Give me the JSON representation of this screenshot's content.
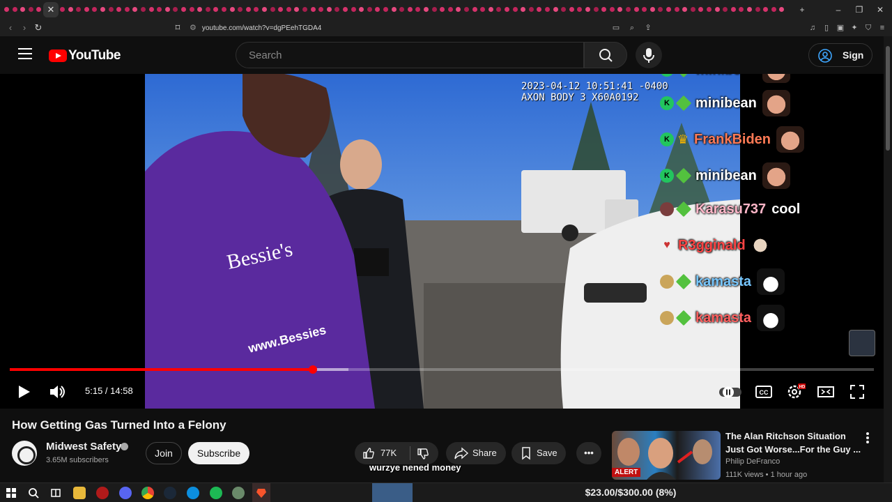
{
  "browser": {
    "url": "youtube.com/watch?v=dgPEehTGDA4",
    "tab_count_visible": 95
  },
  "header": {
    "logo_text": "YouTube",
    "search_placeholder": "Search",
    "signin_label": "Sign in"
  },
  "player": {
    "timestamp_overlay": "2023-04-12 10:51:41 -0400\nAXON BODY 3 X60A0192",
    "time_display": "5:15 / 14:58",
    "progress_played": 0.351,
    "progress_buffered": 0.392,
    "hd_badge": "HD"
  },
  "chat": [
    {
      "name": "minibean",
      "color": "#ffffff",
      "badges": [
        "k",
        "dia"
      ],
      "emote": "face",
      "text": ""
    },
    {
      "name": "minibean",
      "color": "#ffffff",
      "badges": [
        "k",
        "dia"
      ],
      "emote": "face",
      "text": ""
    },
    {
      "name": "FrankBiden",
      "color": "#ff7a55",
      "badges": [
        "k",
        "crown"
      ],
      "emote": "face",
      "text": ""
    },
    {
      "name": "minibean",
      "color": "#ffffff",
      "badges": [
        "k",
        "dia"
      ],
      "emote": "face",
      "text": ""
    },
    {
      "name": "Karasu737",
      "color": "#ffb6c8",
      "badges": [
        "sub",
        "dia"
      ],
      "emote": "",
      "text": "cool"
    },
    {
      "name": "R3gginald",
      "color": "#ff4444",
      "badges": [
        "heart"
      ],
      "emote": "hand",
      "text": ""
    },
    {
      "name": "kamasta",
      "color": "#77c7ff",
      "badges": [
        "gold",
        "dia"
      ],
      "emote": "girl",
      "text": ""
    },
    {
      "name": "kamasta",
      "color": "#ff5f5f",
      "badges": [
        "gold",
        "dia"
      ],
      "emote": "girl",
      "text": ""
    }
  ],
  "video": {
    "title": "How Getting Gas Turned Into a Felony",
    "channel_name": "Midwest Safety",
    "subscribers": "3.65M subscribers",
    "join_label": "Join",
    "subscribe_label": "Subscribe",
    "likes": "77K",
    "share_label": "Share",
    "save_label": "Save",
    "caption": "wurzye nened money"
  },
  "recommended": {
    "title": "The Alan Ritchson Situation Just Got Worse...For the Guy ...",
    "channel": "Philip DeFranco",
    "meta": "111K views • 1 hour ago",
    "thumb_label": "ALERT"
  },
  "taskbar": {
    "goal_text": "$23.00/$300.00 (8%)"
  },
  "colors": {
    "accent_red": "#ff0000",
    "background": "#0f0f0f"
  }
}
